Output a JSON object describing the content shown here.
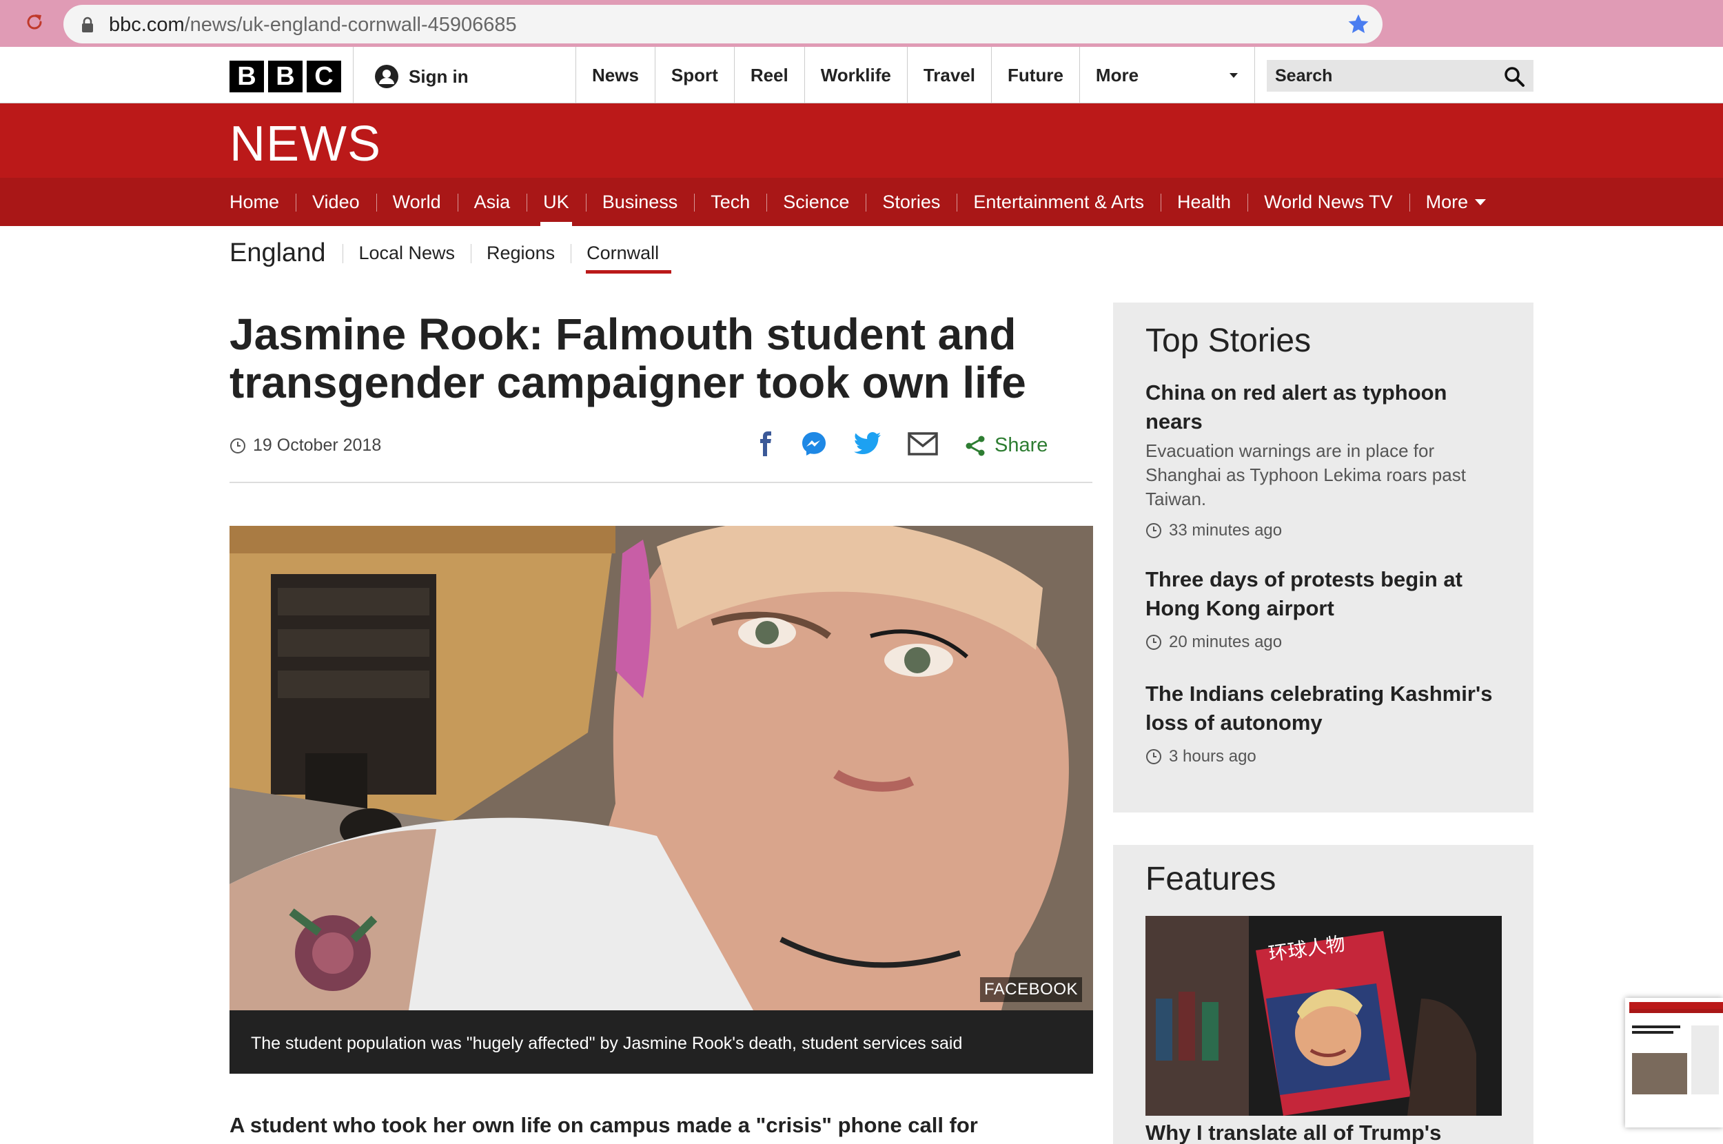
{
  "browser": {
    "url_host": "bbc.com",
    "url_path": "/news/uk-england-cornwall-45906685"
  },
  "topbar": {
    "logo_letters": [
      "B",
      "B",
      "C"
    ],
    "signin_label": "Sign in",
    "nav": [
      "News",
      "Sport",
      "Reel",
      "Worklife",
      "Travel",
      "Future"
    ],
    "more_label": "More",
    "search_label": "Search"
  },
  "banner": {
    "title": "NEWS"
  },
  "section_nav": {
    "items": [
      "Home",
      "Video",
      "World",
      "Asia",
      "UK",
      "Business",
      "Tech",
      "Science",
      "Stories",
      "Entertainment & Arts",
      "Health",
      "World News TV"
    ],
    "active": "UK",
    "more_label": "More"
  },
  "sub_nav": {
    "title": "England",
    "items": [
      "Local News",
      "Regions",
      "Cornwall"
    ],
    "active": "Cornwall"
  },
  "article": {
    "headline": "Jasmine Rook: Falmouth student and transgender campaigner took own life",
    "date": "19 October 2018",
    "share_label": "Share",
    "image_credit": "FACEBOOK",
    "caption": "The student population was \"hugely affected\" by Jasmine Rook's death, student services said",
    "lede": "A student who took her own life on campus made a \"crisis\" phone call for"
  },
  "sidebar": {
    "top_stories_title": "Top Stories",
    "stories": [
      {
        "headline": "China on red alert as typhoon nears",
        "summary": "Evacuation warnings are in place for Shanghai as Typhoon Lekima roars past Taiwan.",
        "time": "33 minutes ago"
      },
      {
        "headline": "Three days of protests begin at Hong Kong airport",
        "summary": "",
        "time": "20 minutes ago"
      },
      {
        "headline": "The Indians celebrating Kashmir's loss of autonomy",
        "summary": "",
        "time": "3 hours ago"
      }
    ],
    "features_title": "Features",
    "feature_headline": "Why I translate all of Trump's",
    "feature_magazine_text": "环球人物"
  },
  "colors": {
    "bbc_red": "#bb1919",
    "section_red": "#a91717",
    "share_green": "#2e7d32",
    "chrome_pink": "#e09bb5"
  }
}
